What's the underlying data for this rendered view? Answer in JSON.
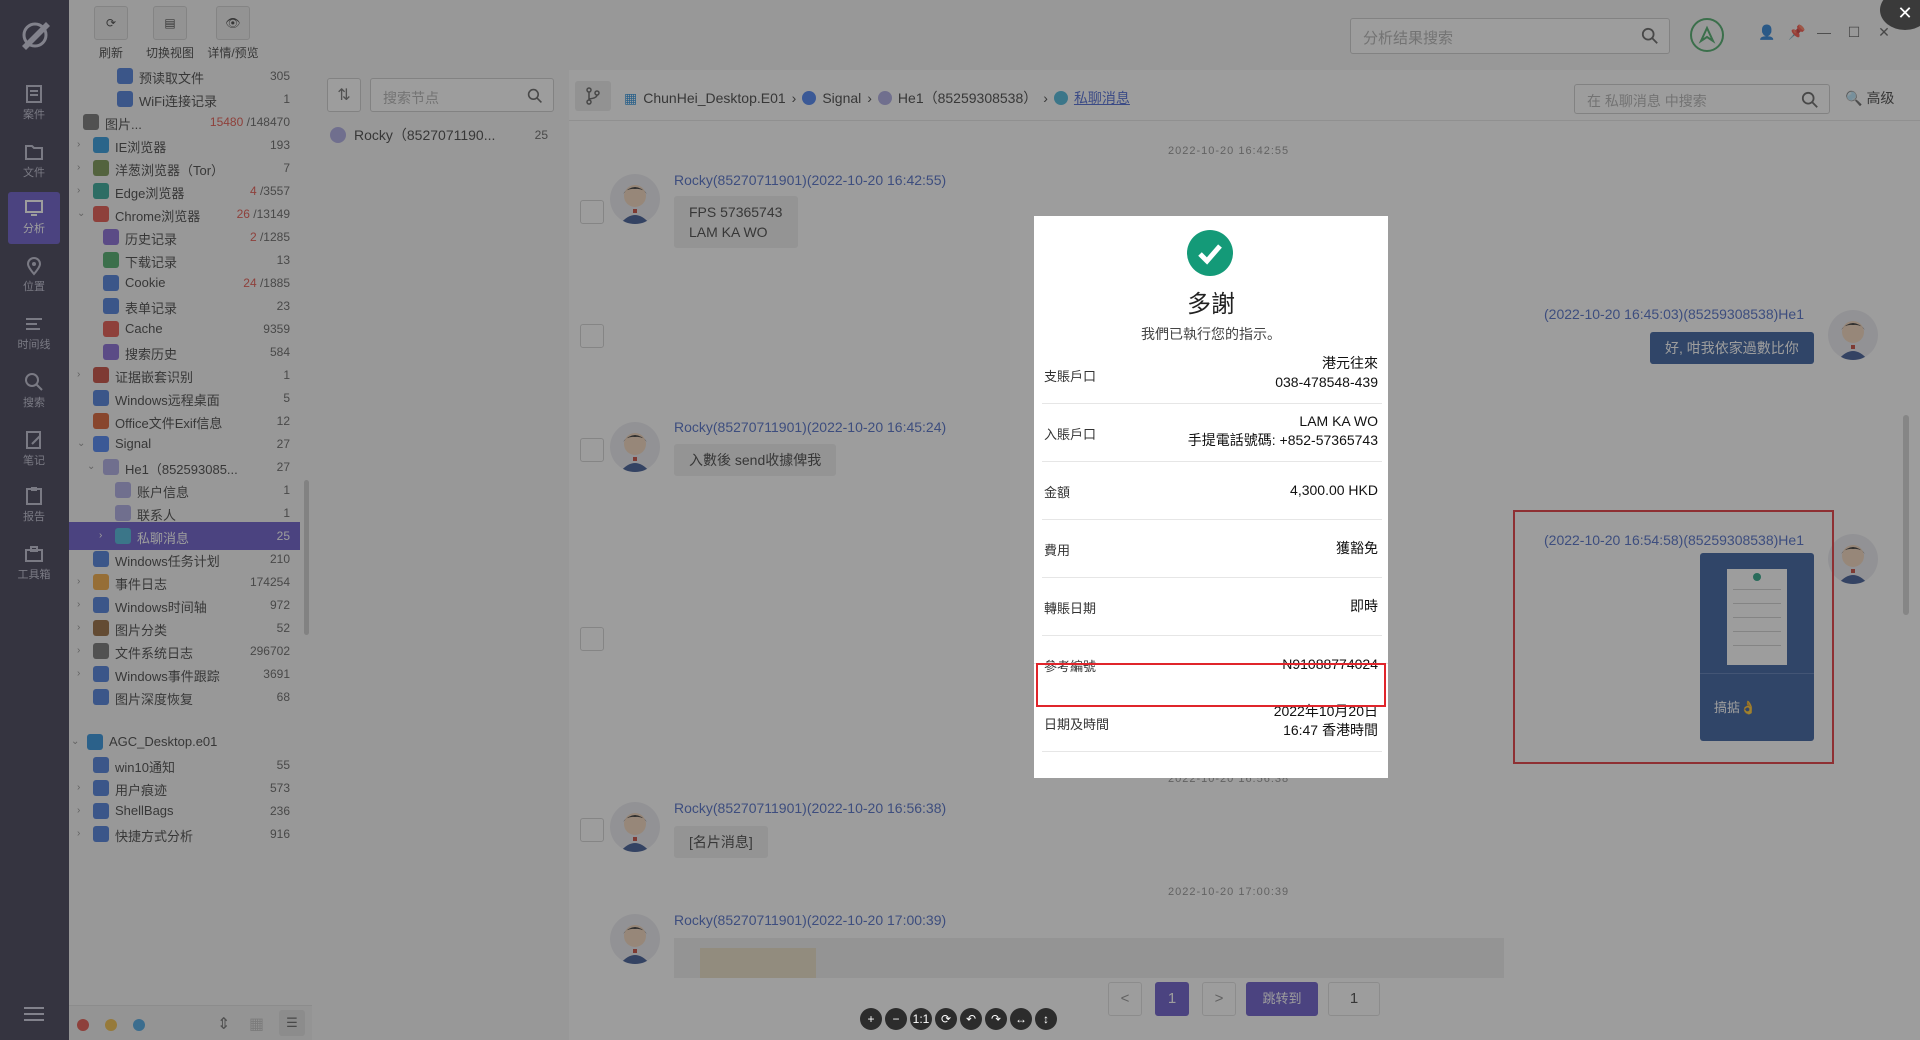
{
  "toolbar": {
    "refresh": "刷新",
    "switch_view": "切换视图",
    "details": "详情/预览"
  },
  "nav": [
    "案件",
    "文件",
    "分析",
    "位置",
    "时间线",
    "搜索",
    "笔记",
    "报告",
    "工具箱"
  ],
  "tree": [
    {
      "label": "预读取文件",
      "count": "305"
    },
    {
      "label": "WiFi连接记录",
      "count": "1"
    },
    {
      "label": "图片...",
      "count_red": "15480",
      "count": "/148470"
    },
    {
      "label": "IE浏览器",
      "count": "193"
    },
    {
      "label": "洋葱浏览器（Tor）",
      "count": "7"
    },
    {
      "label": "Edge浏览器",
      "count_red": "4",
      "count": "/3557"
    },
    {
      "label": "Chrome浏览器",
      "count_red": "26",
      "count": "/13149"
    },
    {
      "label": "历史记录",
      "count_red": "2",
      "count": "/1285"
    },
    {
      "label": "下载记录",
      "count": "13"
    },
    {
      "label": "Cookie",
      "count_red": "24",
      "count": "/1885"
    },
    {
      "label": "表单记录",
      "count": "23"
    },
    {
      "label": "Cache",
      "count": "9359"
    },
    {
      "label": "搜索历史",
      "count": "584"
    },
    {
      "label": "证据嵌套识别",
      "count": "1"
    },
    {
      "label": "Windows远程桌面",
      "count": "5"
    },
    {
      "label": "Office文件Exif信息",
      "count": "12"
    },
    {
      "label": "Signal",
      "count": "27"
    },
    {
      "label": "He1（852593085...",
      "count": "27"
    },
    {
      "label": "账户信息",
      "count": "1"
    },
    {
      "label": "联系人",
      "count": "1"
    },
    {
      "label": "私聊消息",
      "count": "25"
    },
    {
      "label": "Windows任务计划",
      "count": "210"
    },
    {
      "label": "事件日志",
      "count": "174254"
    },
    {
      "label": "Windows时间轴",
      "count": "972"
    },
    {
      "label": "图片分类",
      "count": "52"
    },
    {
      "label": "文件系统日志",
      "count": "296702"
    },
    {
      "label": "Windows事件跟踪",
      "count": "3691"
    },
    {
      "label": "图片深度恢复",
      "count": "68"
    },
    {
      "label": "AGC_Desktop.e01",
      "count": ""
    },
    {
      "label": "win10通知",
      "count": "55"
    },
    {
      "label": "用户痕迹",
      "count": "573"
    },
    {
      "label": "ShellBags",
      "count": "236"
    },
    {
      "label": "快捷方式分析",
      "count": "916"
    }
  ],
  "node_search": {
    "placeholder": "搜索节点"
  },
  "node_item": {
    "label": "Rocky（8527071190...",
    "count": "25"
  },
  "top_search": {
    "placeholder": "分析结果搜索"
  },
  "breadcrumb": {
    "c1": "ChunHei_Desktop.E01",
    "c2": "Signal",
    "c3": "He1（85259308538）",
    "c4": "私聊消息"
  },
  "msg_search": {
    "placeholder": "在 私聊消息 中搜索"
  },
  "advanced": "高级",
  "chat": {
    "ts1": "2022-10-20 16:42:55",
    "m1_sender": "Rocky(85270711901)(2022-10-20 16:42:55)",
    "m1_line1": "FPS 57365743",
    "m1_line2": "LAM KA WO",
    "m2_sender": "(2022-10-20 16:45:03)(85259308538)He1",
    "m2_text": "好, 咁我依家過數比你",
    "m3_sender": "Rocky(85270711901)(2022-10-20 16:45:24)",
    "m3_text": "入數後 send收據俾我",
    "m4_sender": "(2022-10-20 16:54:58)(85259308538)He1",
    "m4_caption": "搞掂👌",
    "ts2": "2022-10-20 16:56:38",
    "m5_sender": "Rocky(85270711901)(2022-10-20 16:56:38)",
    "m5_text": "[名片消息]",
    "ts3": "2022-10-20 17:00:39",
    "m6_sender": "Rocky(85270711901)(2022-10-20 17:00:39)"
  },
  "pager": {
    "prev": "<",
    "page": "1",
    "next": ">",
    "goto": "跳转到",
    "goto_value": "1"
  },
  "receipt": {
    "title": "多謝",
    "subtitle": "我們已執行您的指示。",
    "rows": [
      {
        "label": "支賬戶口",
        "v1": "港元往來",
        "v2": "038-478548-439"
      },
      {
        "label": "入賬戶口",
        "v1": "LAM KA WO",
        "v2": "手提電話號碼: +852-57365743"
      },
      {
        "label": "金額",
        "v1": "4,300.00 HKD",
        "v2": ""
      },
      {
        "label": "費用",
        "v1": "獲豁免",
        "v2": ""
      },
      {
        "label": "轉賬日期",
        "v1": "即時",
        "v2": ""
      },
      {
        "label": "參考編號",
        "v1": "N91088774024",
        "v2": ""
      },
      {
        "label": "日期及時間",
        "v1": "2022年10月20日",
        "v2": "16:47 香港時間"
      }
    ]
  },
  "colors": {
    "accent": "#5b4bc4",
    "nav_bg": "#2e2d44",
    "sender_blue": "#3e5fc0",
    "my_bubble": "#254f94",
    "highlight_red": "#e0252b",
    "check_green": "#149a78"
  }
}
